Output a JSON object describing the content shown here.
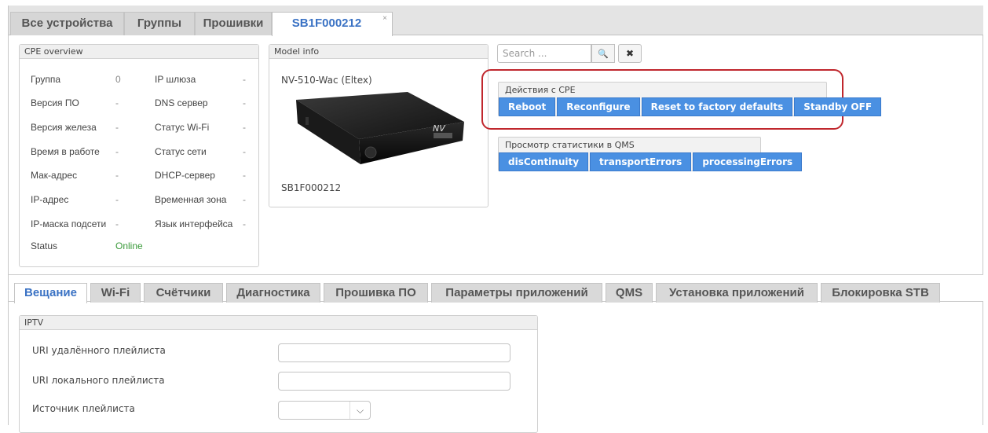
{
  "top_tabs": [
    {
      "label": "Все устройства"
    },
    {
      "label": "Группы"
    },
    {
      "label": "Прошивки"
    },
    {
      "label": "SB1F000212",
      "close": "×"
    }
  ],
  "overview": {
    "title": "CPE overview",
    "left": [
      {
        "label": "Группа",
        "value": "0"
      },
      {
        "label": "Версия ПО",
        "value": "-"
      },
      {
        "label": "Версия железа",
        "value": "-"
      },
      {
        "label": "Время в работе",
        "value": "-"
      },
      {
        "label": "Мак-адрес",
        "value": "-"
      },
      {
        "label": "IP-адрес",
        "value": "-"
      },
      {
        "label": "IP-маска подсети",
        "value": "-"
      },
      {
        "label": "Status",
        "value": "Online"
      }
    ],
    "right": [
      {
        "label": "IP шлюза",
        "value": "-"
      },
      {
        "label": "DNS сервер",
        "value": "-"
      },
      {
        "label": "Статус Wi-Fi",
        "value": "-"
      },
      {
        "label": "Статус сети",
        "value": "-"
      },
      {
        "label": "DHCP-сервер",
        "value": "-"
      },
      {
        "label": "Временная зона",
        "value": "-"
      },
      {
        "label": "Язык интерфейса",
        "value": "-"
      }
    ]
  },
  "model": {
    "title": "Model info",
    "name": "NV-510-Wac (Eltex)",
    "serial": "SB1F000212",
    "device_logo": "NV"
  },
  "search": {
    "placeholder": "Search ...",
    "search_icon": "search-icon",
    "clear_icon": "close-icon",
    "search_glyph": "🔍",
    "clear_glyph": "✖"
  },
  "cpe_actions": {
    "title": "Действия с CPE",
    "buttons": [
      "Reboot",
      "Reconfigure",
      "Reset to factory defaults",
      "Standby OFF"
    ]
  },
  "qms_stats": {
    "title": "Просмотр статистики в QMS",
    "buttons": [
      "disContinuity",
      "transportErrors",
      "processingErrors"
    ]
  },
  "section_tabs": [
    "Вещание",
    "Wi-Fi",
    "Счётчики",
    "Диагностика",
    "Прошивка ПО",
    "Параметры приложений",
    "QMS",
    "Установка приложений",
    "Блокировка STB"
  ],
  "iptv": {
    "title": "IPTV",
    "fields": [
      {
        "label": "URI удалённого плейлиста",
        "value": ""
      },
      {
        "label": "URI локального плейлиста",
        "value": ""
      },
      {
        "label": "Источник плейлиста",
        "value": ""
      }
    ]
  },
  "colors": {
    "accent": "#4a90e2",
    "active_tab": "#3a72c4",
    "online": "#3a9a3a",
    "highlight": "#c0272d"
  }
}
